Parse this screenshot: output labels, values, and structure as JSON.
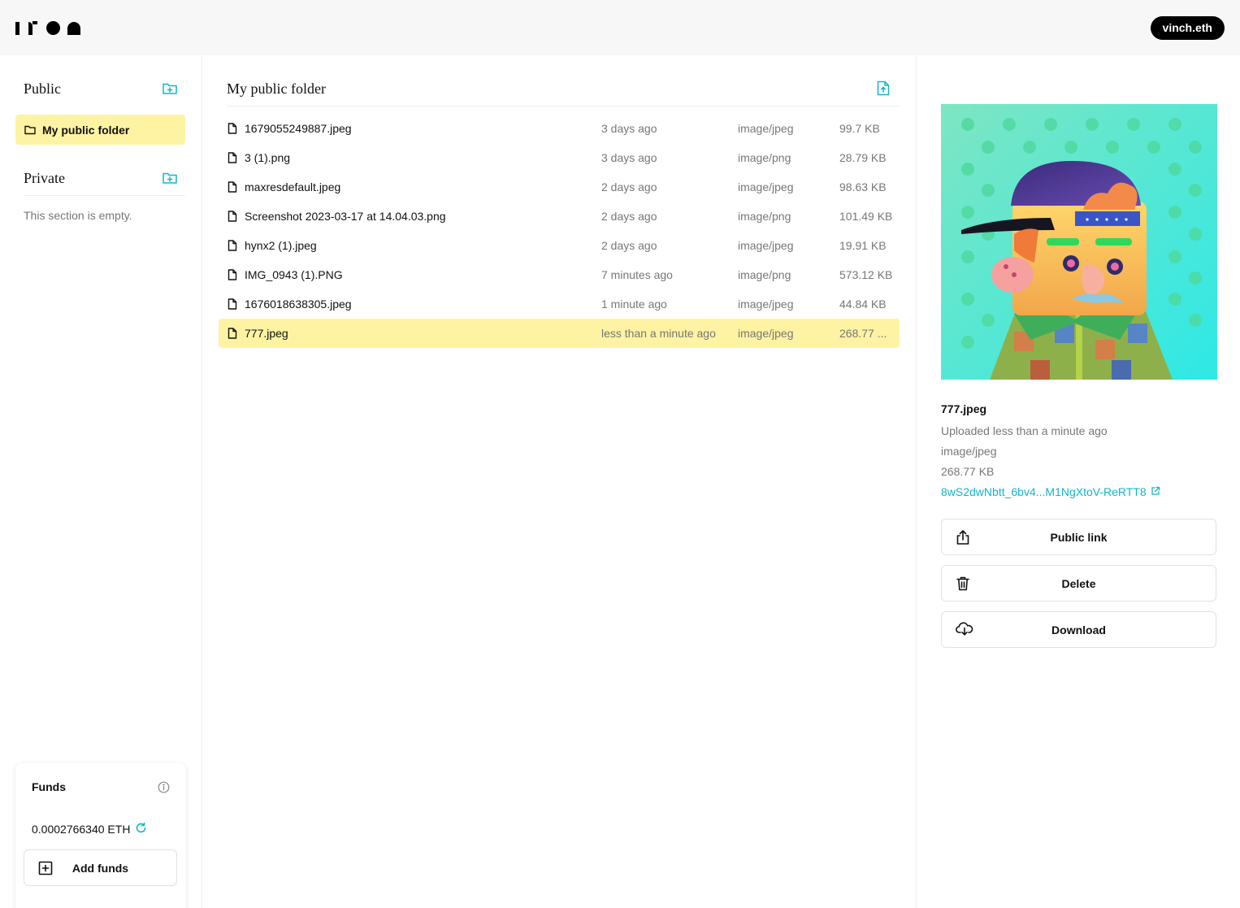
{
  "header": {
    "logo_text": "iron",
    "user": "vinch.eth"
  },
  "sidebar": {
    "public_title": "Public",
    "public_folders": [
      {
        "label": "My public folder"
      }
    ],
    "private_title": "Private",
    "private_empty": "This section is empty."
  },
  "funds": {
    "title": "Funds",
    "amount": "0.0002766340 ETH",
    "add_label": "Add funds"
  },
  "main": {
    "title": "My public folder",
    "files": [
      {
        "name": "1679055249887.jpeg",
        "date": "3 days ago",
        "type": "image/jpeg",
        "size": "99.7 KB"
      },
      {
        "name": "3 (1).png",
        "date": "3 days ago",
        "type": "image/png",
        "size": "28.79 KB"
      },
      {
        "name": "maxresdefault.jpeg",
        "date": "2 days ago",
        "type": "image/jpeg",
        "size": "98.63 KB"
      },
      {
        "name": "Screenshot 2023-03-17 at 14.04.03.png",
        "date": "2 days ago",
        "type": "image/png",
        "size": "101.49 KB"
      },
      {
        "name": "hynx2 (1).jpeg",
        "date": "2 days ago",
        "type": "image/jpeg",
        "size": "19.91 KB"
      },
      {
        "name": "IMG_0943 (1).PNG",
        "date": "7 minutes ago",
        "type": "image/png",
        "size": "573.12 KB"
      },
      {
        "name": "1676018638305.jpeg",
        "date": "1 minute ago",
        "type": "image/jpeg",
        "size": "44.84 KB"
      },
      {
        "name": "777.jpeg",
        "date": "less than a minute ago",
        "type": "image/jpeg",
        "size": "268.77 ..."
      }
    ],
    "selected_index": 7
  },
  "detail": {
    "name": "777.jpeg",
    "uploaded": "Uploaded less than a minute ago",
    "type": "image/jpeg",
    "size": "268.77 KB",
    "cid": "8wS2dwNbtt_6bv4...M1NgXtoV-ReRTT8",
    "actions": {
      "public_link": "Public link",
      "delete": "Delete",
      "download": "Download"
    }
  },
  "colors": {
    "accent": "#12b5cb",
    "selection": "#fdf3a2",
    "muted_text": "#777777"
  }
}
